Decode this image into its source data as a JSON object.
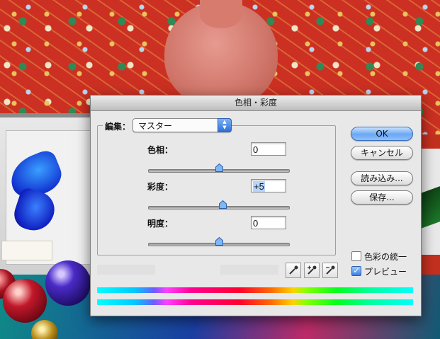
{
  "window": {
    "title": "色相・彩度"
  },
  "edit": {
    "label": "編集：",
    "selected": "マスター"
  },
  "sliders": [
    {
      "label": "色相：",
      "value": "0",
      "slider_fraction": 0.5
    },
    {
      "label": "彩度：",
      "value": "+5",
      "slider_fraction": 0.525
    },
    {
      "label": "明度：",
      "value": "0",
      "slider_fraction": 0.5
    }
  ],
  "buttons": {
    "ok": "OK",
    "cancel": "キャンセル",
    "load": "読み込み...",
    "save": "保存..."
  },
  "checkboxes": {
    "colorize": {
      "label": "色彩の統一",
      "checked": false
    },
    "preview": {
      "label": "プレビュー",
      "checked": true
    }
  },
  "icons": [
    "eyedropper-icon",
    "eyedropper-plus-icon",
    "eyedropper-minus-icon"
  ],
  "colors": {
    "accent": "#3b7fe0",
    "dialog_bg": "#e8e8e8"
  }
}
